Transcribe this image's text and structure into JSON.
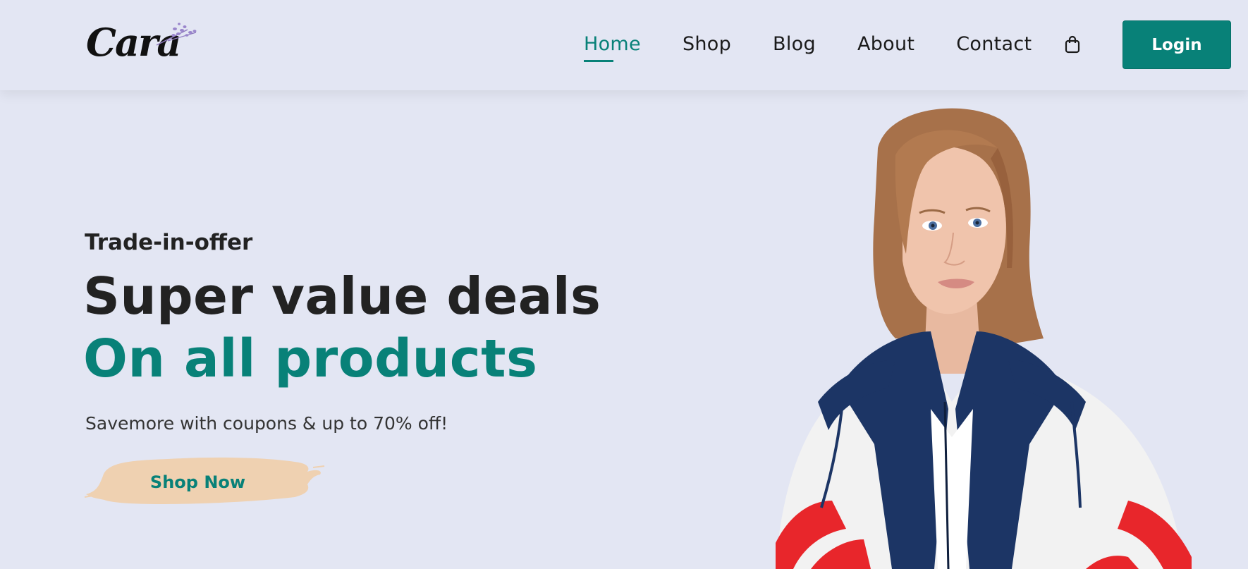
{
  "brand": {
    "logo_text": "Cara"
  },
  "nav": {
    "items": [
      {
        "label": "Home",
        "active": true
      },
      {
        "label": "Shop",
        "active": false
      },
      {
        "label": "Blog",
        "active": false
      },
      {
        "label": "About",
        "active": false
      },
      {
        "label": "Contact",
        "active": false
      }
    ],
    "cart_icon": "shopping-bag-icon",
    "login_label": "Login"
  },
  "hero": {
    "eyebrow": "Trade-in-offer",
    "headline_line1": "Super value deals",
    "headline_line2": "On all products",
    "subtext": "Savemore with coupons & up to 70% off!",
    "cta_label": "Shop Now"
  },
  "colors": {
    "background": "#e3e6f3",
    "accent": "#088178",
    "cta_brush": "#efd1b1",
    "text_dark": "#222222"
  }
}
